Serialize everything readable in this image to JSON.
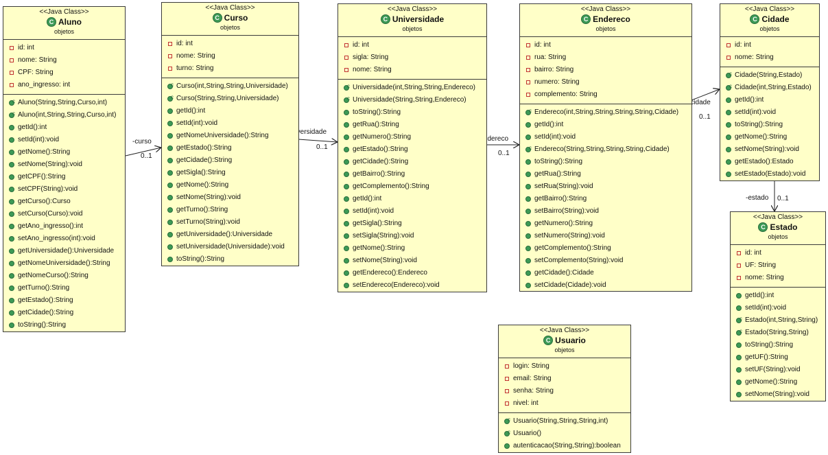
{
  "stereotype": "<<Java Class>>",
  "package": "objetos",
  "classes": {
    "aluno": {
      "name": "Aluno",
      "attributes": [
        "id: int",
        "nome: String",
        "CPF: String",
        "ano_ingresso: int"
      ],
      "constructors": [
        "Aluno(String,String,Curso,int)",
        "Aluno(int,String,String,Curso,int)"
      ],
      "methods": [
        "getId():int",
        "setId(int):void",
        "getNome():String",
        "setNome(String):void",
        "getCPF():String",
        "setCPF(String):void",
        "getCurso():Curso",
        "setCurso(Curso):void",
        "getAno_ingresso():int",
        "setAno_ingresso(int):void",
        "getUniversidade():Universidade",
        "getNomeUniversidade():String",
        "getNomeCurso():String",
        "getTurno():String",
        "getEstado():String",
        "getCidade():String",
        "toString():String"
      ]
    },
    "curso": {
      "name": "Curso",
      "attributes": [
        "id: int",
        "nome: String",
        "turno: String"
      ],
      "constructors": [
        "Curso(int,String,String,Universidade)",
        "Curso(String,String,Universidade)"
      ],
      "methods": [
        "getId():int",
        "setId(int):void",
        "getNomeUniversidade():String",
        "getEstado():String",
        "getCidade():String",
        "getSigla():String",
        "getNome():String",
        "setNome(String):void",
        "getTurno():String",
        "setTurno(String):void",
        "getUniversidade():Universidade",
        "setUniversidade(Universidade):void",
        "toString():String"
      ]
    },
    "universidade": {
      "name": "Universidade",
      "attributes": [
        "id: int",
        "sigla: String",
        "nome: String"
      ],
      "constructors": [
        "Universidade(int,String,String,Endereco)",
        "Universidade(String,String,Endereco)"
      ],
      "methods": [
        "toString():String",
        "getRua():String",
        "getNumero():String",
        "getEstado():String",
        "getCidade():String",
        "getBairro():String",
        "getComplemento():String",
        "getId():int",
        "setId(int):void",
        "getSigla():String",
        "setSigla(String):void",
        "getNome():String",
        "setNome(String):void",
        "getEndereco():Endereco",
        "setEndereco(Endereco):void"
      ]
    },
    "endereco": {
      "name": "Endereco",
      "attributes": [
        "id: int",
        "rua: String",
        "bairro: String",
        "numero: String",
        "complemento: String"
      ],
      "constructors": [
        "Endereco(int,String,String,String,String,Cidade)"
      ],
      "methods": [
        "getId():int",
        "setId(int):void"
      ],
      "constructors2": [
        "Endereco(String,String,String,String,Cidade)"
      ],
      "methods2": [
        "toString():String",
        "getRua():String",
        "setRua(String):void",
        "getBairro():String",
        "setBairro(String):void",
        "getNumero():String",
        "setNumero(String):void",
        "getComplemento():String",
        "setComplemento(String):void",
        "getCidade():Cidade",
        "setCidade(Cidade):void"
      ]
    },
    "cidade": {
      "name": "Cidade",
      "attributes": [
        "id: int",
        "nome: String"
      ],
      "constructors": [
        "Cidade(String,Estado)",
        "Cidade(int,String,Estado)"
      ],
      "methods": [
        "getId():int",
        "setId(int):void",
        "toString():String",
        "getNome():String",
        "setNome(String):void",
        "getEstado():Estado",
        "setEstado(Estado):void"
      ]
    },
    "estado": {
      "name": "Estado",
      "attributes": [
        "id: int",
        "UF: String",
        "nome: String"
      ],
      "methods": [
        "getId():int",
        "setId(int):void"
      ],
      "constructors": [
        "Estado(int,String,String)",
        "Estado(String,String)"
      ],
      "methods2": [
        "toString():String",
        "getUF():String",
        "setUF(String):void",
        "getNome():String",
        "setNome(String):void"
      ]
    },
    "usuario": {
      "name": "Usuario",
      "attributes": [
        "login: String",
        "email: String",
        "senha: String",
        "nivel: int"
      ],
      "constructors": [
        "Usuario(String,String,String,int)",
        "Usuario()"
      ],
      "methods": [
        "autenticacao(String,String):boolean"
      ]
    }
  },
  "associations": {
    "curso": {
      "role": "-curso",
      "multiplicity": "0..1"
    },
    "universidade": {
      "role": "-universidade",
      "multiplicity": "0..1"
    },
    "endereco": {
      "role": "-endereco",
      "multiplicity": "0..1"
    },
    "cidade": {
      "role": "-cidade",
      "multiplicity": "0..1"
    },
    "estado": {
      "role": "-estado",
      "multiplicity": "0..1"
    }
  },
  "colors": {
    "class_fill": "#ffffc8",
    "border": "#3a3a3a",
    "method_icon": "#3d9a56",
    "attribute_icon": "#c03030"
  }
}
